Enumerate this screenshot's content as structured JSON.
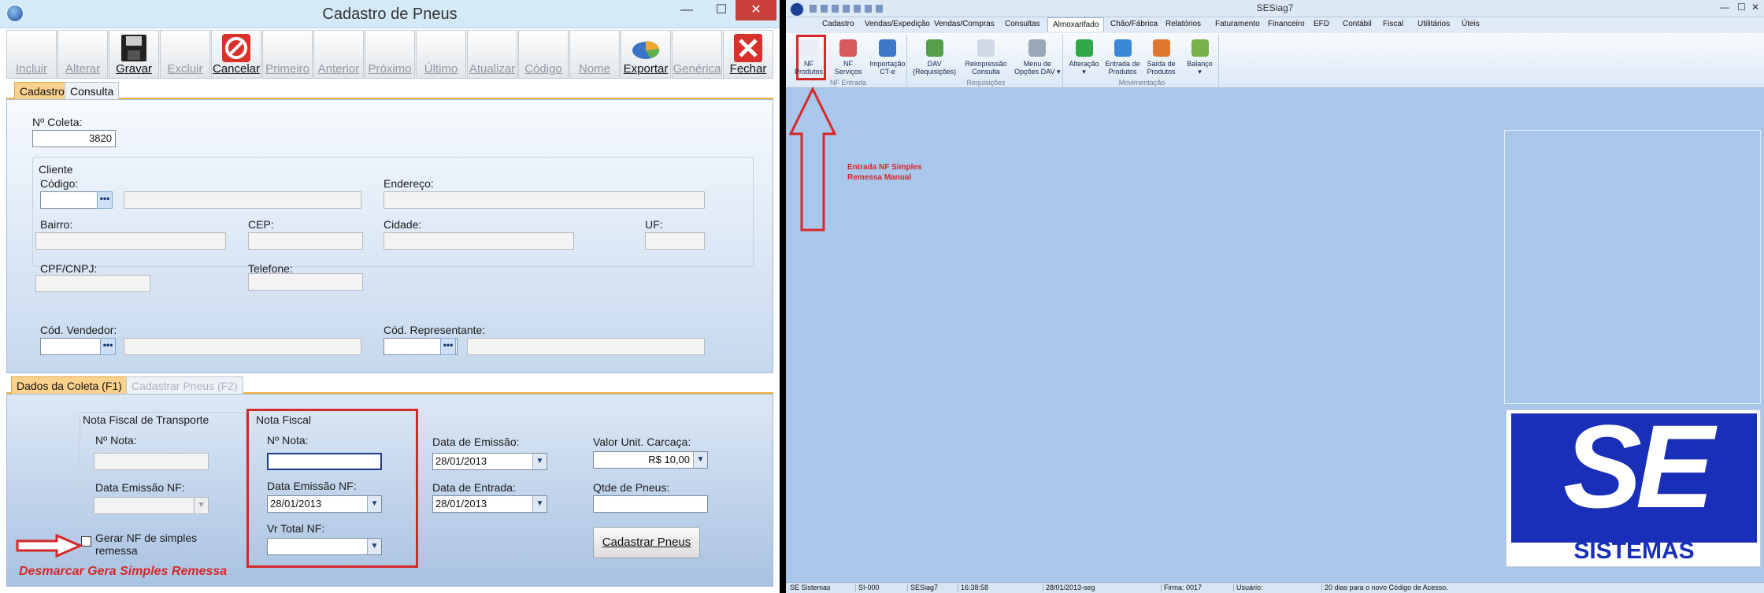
{
  "left_window": {
    "title": "Cadastro de Pneus",
    "minimize": "—",
    "maximize": "☐",
    "close": "✕",
    "toolbar": [
      {
        "label": "Incluir",
        "enabled": false
      },
      {
        "label": "Alterar",
        "enabled": false
      },
      {
        "label": "Gravar",
        "enabled": true,
        "icon": "floppy-disk-icon"
      },
      {
        "label": "Excluir",
        "enabled": false
      },
      {
        "label": "Cancelar",
        "enabled": true,
        "icon": "cancel-icon"
      },
      {
        "label": "Primeiro",
        "enabled": false
      },
      {
        "label": "Anterior",
        "enabled": false
      },
      {
        "label": "Próximo",
        "enabled": false
      },
      {
        "label": "Último",
        "enabled": false
      },
      {
        "label": "Atualizar",
        "enabled": false
      },
      {
        "label": "Código",
        "enabled": false
      },
      {
        "label": "Nome",
        "enabled": false
      },
      {
        "label": "Exportar",
        "enabled": true,
        "icon": "pie-chart-icon"
      },
      {
        "label": "Genérica",
        "enabled": false
      },
      {
        "label": "Fechar",
        "enabled": true,
        "icon": "close-icon"
      }
    ],
    "tabs": {
      "cadastro": "Cadastro",
      "consulta": "Consulta"
    },
    "form": {
      "coleta_label": "Nº Coleta:",
      "coleta_value": "3820",
      "cliente_group": "Cliente",
      "codigo": "Código:",
      "endereco": "Endereço:",
      "bairro": "Bairro:",
      "cep": "CEP:",
      "cidade": "Cidade:",
      "uf": "UF:",
      "cpf": "CPF/CNPJ:",
      "telefone": "Telefone:",
      "vendedor": "Cód. Vendedor:",
      "representante": "Cód. Representante:",
      "dots": "•••"
    },
    "subtabs": {
      "dados": "Dados da Coleta (F1)",
      "cadastrar": "Cadastrar Pneus (F2)"
    },
    "dados": {
      "nf_transporte_group": "Nota Fiscal de Transporte",
      "nf_transporte_nota": "Nº Nota:",
      "nf_transporte_data": "Data Emissão NF:",
      "gerar_nf_label": "Gerar NF de simples remessa",
      "nota_fiscal_group": "Nota Fiscal",
      "nota_label": "Nº Nota:",
      "nota_value": "",
      "data_emissao_nf_label": "Data Emissão NF:",
      "data_emissao_nf_value": "28/01/2013",
      "vr_total_label": "Vr Total NF:",
      "vr_total_value": "",
      "data_emissao_label": "Data de Emissão:",
      "data_emissao_value": "28/01/2013",
      "data_entrada_label": "Data de Entrada:",
      "data_entrada_value": "28/01/2013",
      "valor_unit_label": "Valor Unit. Carcaça:",
      "valor_unit_value": "R$ 10,00",
      "qtde_label": "Qtde de Pneus:",
      "qtde_value": "",
      "cadastrar_button": "Cadastrar Pneus"
    },
    "annotation": "Desmarcar Gera Simples Remessa"
  },
  "right_window": {
    "title": "SESiag7",
    "menu": [
      "Cadastro",
      "Vendas/Expedição",
      "Vendas/Compras",
      "Consultas",
      "Almoxarifado",
      "Chão/Fábrica",
      "Relatórios",
      "Faturamento",
      "Financeiro",
      "EFD",
      "Contábil",
      "Fiscal",
      "Utilitários",
      "Úteis"
    ],
    "selected_menu": "Almoxarifado",
    "ribbon_groups": [
      {
        "label": "NF Entrada",
        "buttons": [
          {
            "l1": "NF",
            "l2": "Produtos"
          },
          {
            "l1": "NF",
            "l2": "Serviços"
          },
          {
            "l1": "Importação",
            "l2": "CT-e"
          }
        ]
      },
      {
        "label": "Requisições",
        "buttons": [
          {
            "l1": "DAV",
            "l2": "(Requisições)"
          },
          {
            "l1": "Reimpressão",
            "l2": "Consulta"
          },
          {
            "l1": "Menu de",
            "l2": "Opções DAV ▾"
          }
        ]
      },
      {
        "label": "Movimentação",
        "buttons": [
          {
            "l1": "Alteração",
            "l2": "▾"
          },
          {
            "l1": "Entrada de",
            "l2": "Produtos"
          },
          {
            "l1": "Saída de",
            "l2": "Produtos"
          },
          {
            "l1": "Balanço",
            "l2": "▾"
          }
        ]
      }
    ],
    "annotation_line1": "Entrada NF Simples",
    "annotation_line2": "Remessa Manual",
    "logo_text": "SE",
    "logo_subtext": "SISTEMAS",
    "status": [
      "SE Sistemas",
      "SI-000",
      "SESiag7",
      "16:38:58",
      "28/01/2013-seg",
      "Firma: 0017",
      "Usuário:",
      "20 dias para o novo Código de Acesso."
    ]
  },
  "colors": {
    "accent_red": "#d52828",
    "tab_orange": "#fbd28d",
    "desktop_blue": "#a9c7ea",
    "logo_blue": "#1a2fb8"
  }
}
